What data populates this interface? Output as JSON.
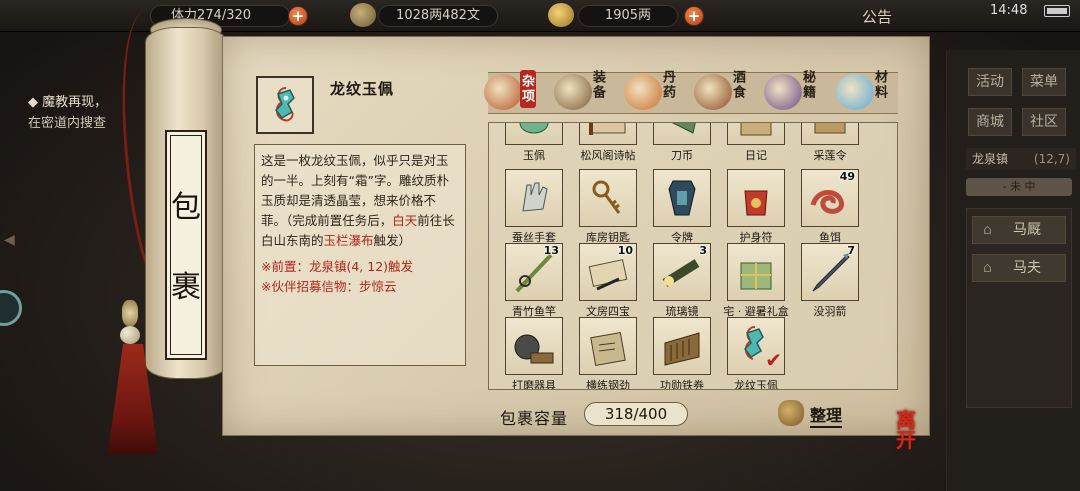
{
  "topbar": {
    "stamina": "274/320",
    "stamina_prefix": "体力",
    "money": "1028两482文",
    "gold": "1905两",
    "announce": "公告",
    "time": "14:48"
  },
  "quest": {
    "title": "◆ 魔教再现，",
    "desc": "在密道内搜查"
  },
  "right_panel": {
    "buttons": [
      "活动",
      "菜单",
      "商城",
      "社区"
    ],
    "location": "龙泉镇",
    "coords": "(12,7)",
    "mini": "- 未 中",
    "npcs": [
      "马厩",
      "马夫"
    ]
  },
  "bag_title": [
    "包",
    "裹"
  ],
  "detail": {
    "name": "龙纹玉佩",
    "desc_part1": "这是一枚龙纹玉佩，似乎只是对玉的一半。上刻有“霜”字。雕纹质朴玉质却是清透晶莹，想来价格不菲。（完成前置任务后，",
    "desc_hl1": "白天",
    "desc_part2": "前往长白山东南的",
    "desc_hl2": "玉栏瀑布",
    "desc_part3": "触发）",
    "req1": "※前置：龙泉镇(4, 12)触发",
    "req2": "※伙伴招募信物：步惊云"
  },
  "tabs": [
    {
      "label": "杂项",
      "icon": "sundries-jar-icon",
      "active": true
    },
    {
      "label": "装备",
      "icon": "equipment-icon",
      "active": false
    },
    {
      "label": "丹药",
      "icon": "elixir-icon",
      "active": false
    },
    {
      "label": "酒食",
      "icon": "food-icon",
      "active": false
    },
    {
      "label": "秘籍",
      "icon": "book-icon",
      "active": false
    },
    {
      "label": "材料",
      "icon": "crystal-icon",
      "active": false
    }
  ],
  "items": [
    {
      "name": "玉佩",
      "count": "",
      "icon": "jade-icon"
    },
    {
      "name": "松风阁诗帖",
      "count": "",
      "icon": "scroll-icon"
    },
    {
      "name": "刀币",
      "count": "",
      "icon": "coin-knife-icon"
    },
    {
      "name": "日记",
      "count": "",
      "icon": "diary-icon"
    },
    {
      "name": "采莲令",
      "count": "",
      "icon": "token-icon"
    },
    {
      "name": "蚕丝手套",
      "count": "",
      "icon": "glove-icon"
    },
    {
      "name": "库房钥匙",
      "count": "",
      "icon": "key-icon"
    },
    {
      "name": "令牌",
      "count": "",
      "icon": "command-token-icon"
    },
    {
      "name": "护身符",
      "count": "",
      "icon": "amulet-icon"
    },
    {
      "name": "鱼饵",
      "count": "49",
      "icon": "worm-bait-icon"
    },
    {
      "name": "青竹鱼竿",
      "count": "13",
      "icon": "fishing-rod-icon"
    },
    {
      "name": "文房四宝",
      "count": "10",
      "icon": "stationery-icon"
    },
    {
      "name": "琉璃镜",
      "count": "3",
      "icon": "spyglass-icon"
    },
    {
      "name": "宅 · 避暑礼盒",
      "count": "",
      "icon": "gift-box-icon"
    },
    {
      "name": "没羽箭",
      "count": "7",
      "icon": "dart-icon"
    },
    {
      "name": "打磨器具",
      "count": "",
      "icon": "grindstone-icon"
    },
    {
      "name": "横练钢劲",
      "count": "",
      "icon": "manual-icon"
    },
    {
      "name": "功勋铁券",
      "count": "",
      "icon": "iron-tablet-icon"
    },
    {
      "name": "龙纹玉佩",
      "count": "",
      "icon": "dragon-pendant-icon",
      "selected": true
    }
  ],
  "capacity": {
    "label": "包裹容量",
    "value": "318/400"
  },
  "sort_label": "整理",
  "leave_label": "离开",
  "colors": {
    "accent_red": "#b5261a",
    "parchment": "#ddd0b1",
    "jade": "#4fb6b0"
  }
}
